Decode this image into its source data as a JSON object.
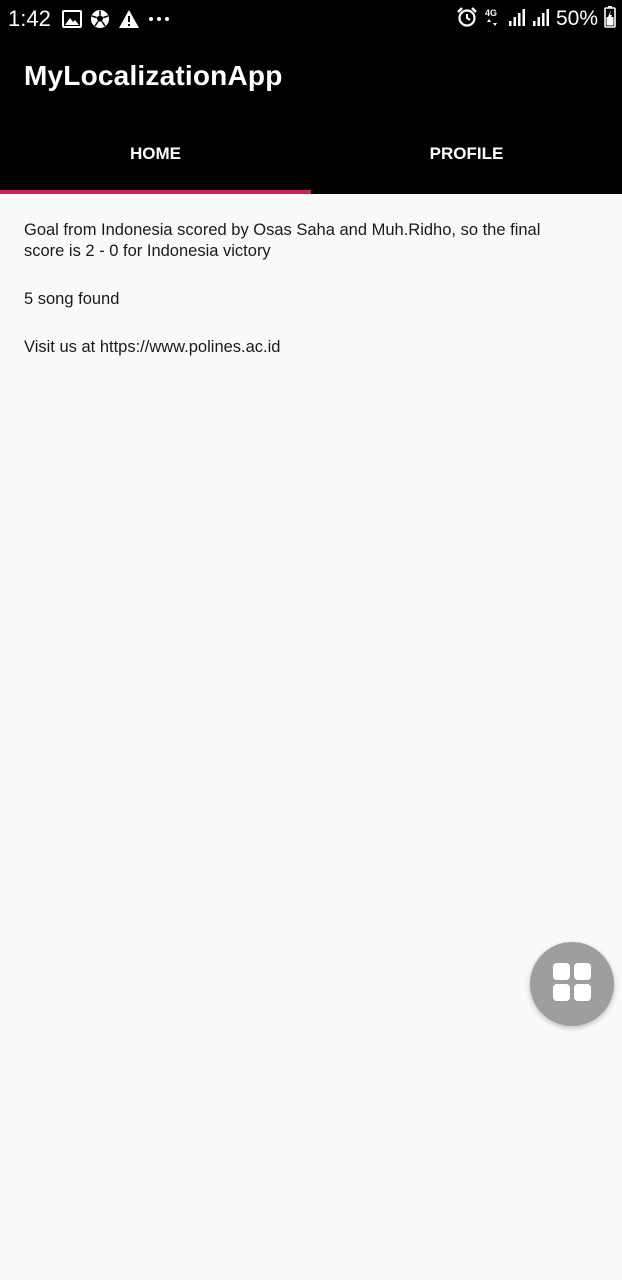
{
  "status_bar": {
    "time": "1:42",
    "left_icons": [
      "image-icon",
      "soccer-ball-icon",
      "warning-icon",
      "more-dots-icon"
    ],
    "right_icons": [
      "alarm-icon",
      "4g-icon",
      "signal-icon",
      "signal-icon",
      "battery-icon"
    ],
    "network_label": "4G",
    "battery_percent": "50%"
  },
  "app_bar": {
    "title": "MyLocalizationApp",
    "background": "#000000"
  },
  "tabs": [
    {
      "label": "HOME",
      "selected": true
    },
    {
      "label": "PROFILE",
      "selected": false
    }
  ],
  "tab_indicator_color": "#d81b60",
  "main": {
    "paragraphs": [
      "Goal from Indonesia scored by Osas Saha and Muh.Ridho, so the final score is 2 - 0 for Indonesia victory",
      "5 song found",
      "Visit us at https://www.polines.ac.id"
    ]
  },
  "fab": {
    "icon": "grid-icon",
    "color": "#9e9e9e"
  }
}
